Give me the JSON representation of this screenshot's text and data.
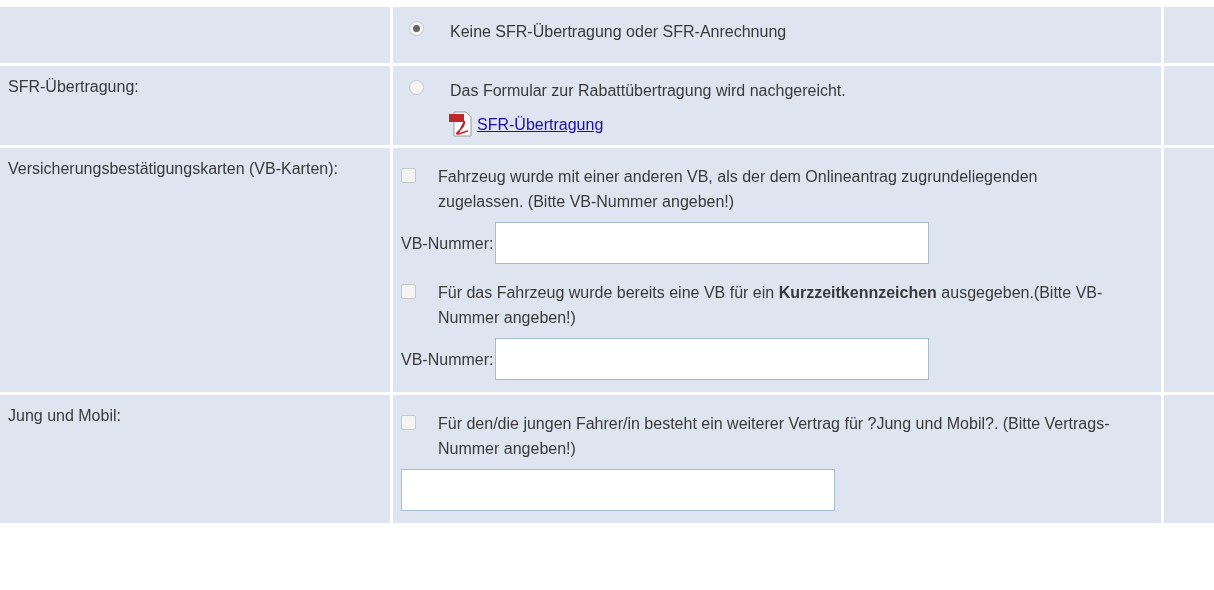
{
  "rows": [
    {
      "label": "",
      "items": [
        {
          "kind": "radio",
          "text": "Keine SFR-Übertragung oder SFR-Anrechnung",
          "selected": true
        }
      ]
    },
    {
      "label": "SFR-Übertragung:",
      "items": [
        {
          "kind": "radio",
          "text": "Das Formular zur Rabattübertragung wird nachgereicht.",
          "selected": false
        },
        {
          "kind": "pdf-link",
          "text": "SFR-Übertragung"
        }
      ]
    },
    {
      "label": "Versicherungsbestätigungskarten (VB-Karten):",
      "items": [
        {
          "kind": "checkbox",
          "text": "Fahrzeug wurde mit einer anderen VB, als der dem Onlineantrag zugrundeliegenden zugelassen. (Bitte VB-Nummer angeben!)",
          "checked": false
        },
        {
          "kind": "field",
          "label": "VB-Nummer:"
        },
        {
          "kind": "checkbox",
          "text": "Für das Fahrzeug wurde bereits eine VB für ein **Kurzzeitkennzeichen** ausgegeben.(Bitte VB-Nummer angeben!)",
          "checked": false
        },
        {
          "kind": "field",
          "label": "VB-Nummer:"
        }
      ]
    },
    {
      "label": "Jung und Mobil:",
      "items": [
        {
          "kind": "checkbox",
          "text": "Für den/die jungen Fahrer/in besteht ein weiterer Vertrag für ?Jung und Mobil?. (Bitte Vertrags-Nummer angeben!)",
          "checked": false
        },
        {
          "kind": "field"
        }
      ]
    }
  ]
}
